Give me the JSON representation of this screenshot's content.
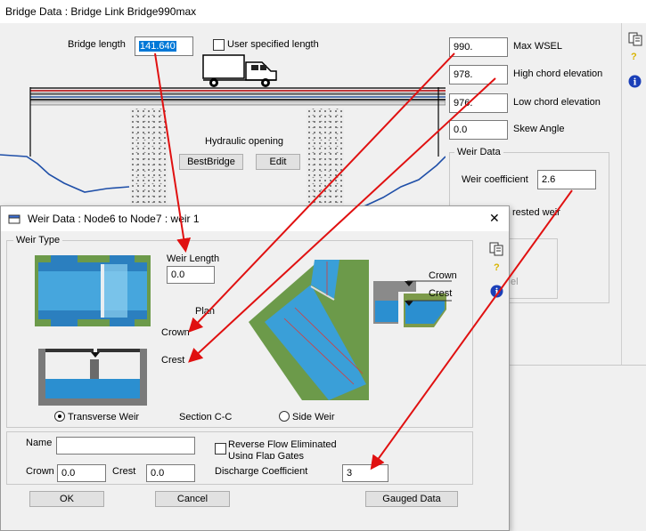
{
  "bridge_window": {
    "title": "Bridge Data : Bridge Link Bridge990max",
    "bridge_length_label": "Bridge length",
    "bridge_length_value": "141.640",
    "user_specified_length_label": "User specified length",
    "max_wsel_value": "990.",
    "max_wsel_label": "Max WSEL",
    "high_chord_value": "978.",
    "high_chord_label": "High chord elevation",
    "low_chord_value": "976.",
    "low_chord_label": "Low chord elevation",
    "skew_value": "0.0",
    "skew_label": "Skew Angle",
    "hydraulic_opening_label": "Hydraulic opening",
    "bestbridge_button": "BestBridge",
    "edit_button": "Edit",
    "weir_data_group": "Weir Data",
    "weir_coefficient_label": "Weir coefficient",
    "weir_coefficient_value": "2.6",
    "partial_label_1": "rested weir",
    "partial_label_2": "el",
    "toolbar_icons": [
      "copy-icon",
      "help-icon",
      "info-icon"
    ]
  },
  "weir_dialog": {
    "title": "Weir Data : Node6 to Node7 : weir 1",
    "close_glyph": "✕",
    "weir_type_group": "Weir Type",
    "weir_length_label": "Weir Length",
    "weir_length_value": "0.0",
    "plan_label": "Plan",
    "crown_label": "Crown",
    "crest_label": "Crest",
    "transverse_weir_label": "Transverse Weir",
    "section_label": "Section C-C",
    "side_weir_label": "Side Weir",
    "side_crown_label": "Crown",
    "side_crest_label": "Crest",
    "name_label": "Name",
    "name_value": "",
    "reverse_flow_label_1": "Reverse Flow Eliminated",
    "reverse_flow_label_2": "Using Flap Gates",
    "crown_field_label": "Crown",
    "crown_field_value": "0.0",
    "crest_field_label": "Crest",
    "crest_field_value": "0.0",
    "discharge_coefficient_label": "Discharge Coefficient",
    "discharge_coefficient_value": "3",
    "ok_button": "OK",
    "cancel_button": "Cancel",
    "gauged_data_button": "Gauged Data",
    "toolbar_icons": [
      "copy-icon",
      "help-icon",
      "info-icon"
    ]
  },
  "colors": {
    "annotation_arrow": "#e01010",
    "water": "#3aa0d8",
    "selection": "#0078d7"
  }
}
